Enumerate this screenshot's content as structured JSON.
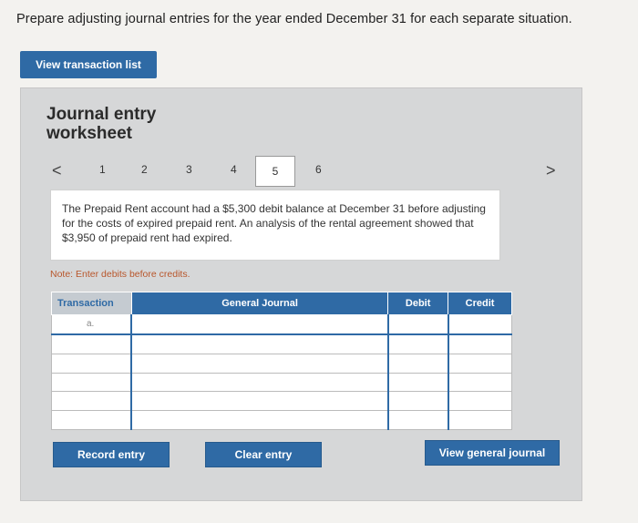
{
  "instruction": "Prepare adjusting journal entries for the year ended December 31 for each separate situation.",
  "view_transaction_list": "View transaction list",
  "panel": {
    "title": "Journal entry worksheet",
    "pager": {
      "prev": "<",
      "next": ">",
      "pages": [
        "1",
        "2",
        "3",
        "4",
        "5",
        "6"
      ],
      "active_page": "5"
    },
    "scenario_text": "The Prepaid Rent account had a $5,300 debit balance at December 31 before adjusting for the costs of expired prepaid rent. An analysis of the rental agreement showed that $3,950 of prepaid rent had expired.",
    "note": "Note: Enter debits before credits.",
    "table": {
      "headers": [
        "Transaction",
        "General Journal",
        "Debit",
        "Credit"
      ],
      "rows": [
        {
          "transaction": "a.",
          "general_journal": "",
          "debit": "",
          "credit": ""
        },
        {
          "transaction": "",
          "general_journal": "",
          "debit": "",
          "credit": ""
        },
        {
          "transaction": "",
          "general_journal": "",
          "debit": "",
          "credit": ""
        },
        {
          "transaction": "",
          "general_journal": "",
          "debit": "",
          "credit": ""
        },
        {
          "transaction": "",
          "general_journal": "",
          "debit": "",
          "credit": ""
        },
        {
          "transaction": "",
          "general_journal": "",
          "debit": "",
          "credit": ""
        }
      ]
    },
    "buttons": {
      "record": "Record entry",
      "clear": "Clear entry",
      "view_general_journal": "View general journal"
    }
  },
  "colors": {
    "accent": "#2f6aa5",
    "panel_bg": "#d6d7d8",
    "note": "#b8562b"
  }
}
